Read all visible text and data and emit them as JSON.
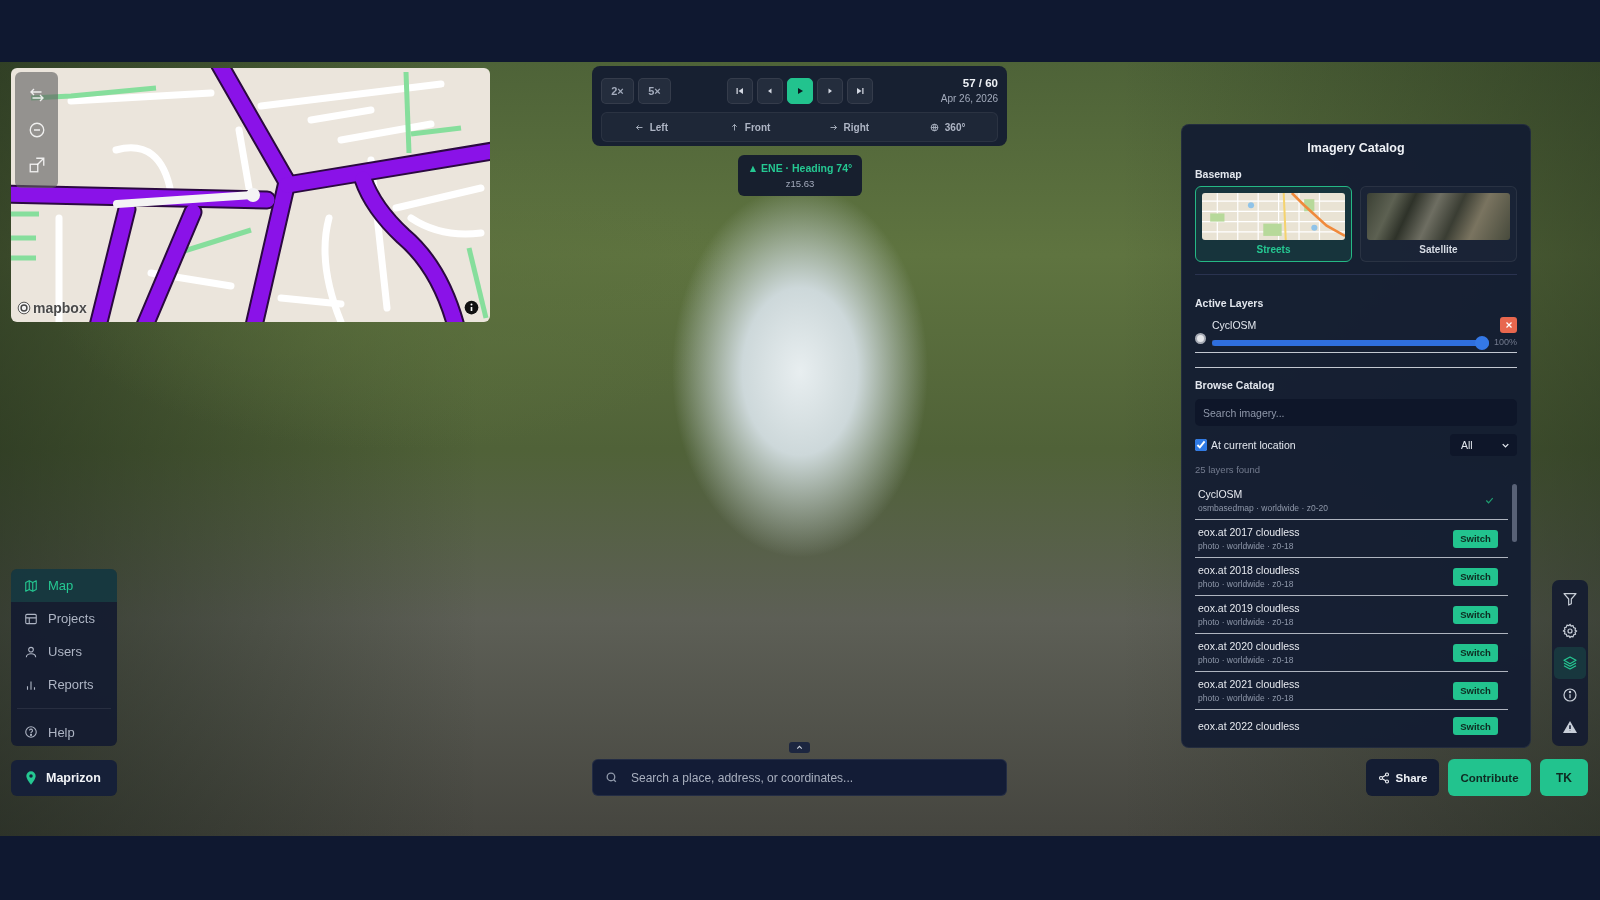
{
  "map_inset": {
    "attribution": "mapbox"
  },
  "playback": {
    "speeds": [
      {
        "label": "2×"
      },
      {
        "label": "5×"
      }
    ],
    "counter": "57 / 60",
    "date": "Apr 26, 2026",
    "directions": [
      {
        "kind": "left",
        "label": "Left"
      },
      {
        "kind": "front",
        "label": "Front"
      },
      {
        "kind": "right",
        "label": "Right"
      },
      {
        "kind": "panorama",
        "label": "360°"
      }
    ]
  },
  "heading": {
    "direction": "▲ ENE · Heading 74°",
    "zoom": "z15.63"
  },
  "imagery_catalog": {
    "title": "Imagery Catalog",
    "basemap_label": "Basemap",
    "basemaps": [
      {
        "kind": "streets",
        "label": "Streets",
        "selected": true
      },
      {
        "kind": "satellite",
        "label": "Satellite",
        "selected": false
      }
    ],
    "active_layers_label": "Active Layers",
    "active_layers": [
      {
        "name": "CyclOSM",
        "selected": false,
        "level": 1,
        "reading": "100%"
      }
    ],
    "browse_label": "Browse Catalog",
    "search": {
      "placeholder": "Search imagery..."
    },
    "at_current_location": {
      "label": "At current location",
      "checked": true
    },
    "filter": {
      "value": "All"
    },
    "results_count": "25 layers found",
    "layers": [
      {
        "name": "CyclOSM",
        "meta": "osmbasedmap · worldwide · z0-20",
        "active": true
      },
      {
        "name": "eox.at 2017 cloudless",
        "meta": "photo · worldwide · z0-18",
        "active": false,
        "action": "Switch"
      },
      {
        "name": "eox.at 2018 cloudless",
        "meta": "photo · worldwide · z0-18",
        "active": false,
        "action": "Switch"
      },
      {
        "name": "eox.at 2019 cloudless",
        "meta": "photo · worldwide · z0-18",
        "active": false,
        "action": "Switch"
      },
      {
        "name": "eox.at 2020 cloudless",
        "meta": "photo · worldwide · z0-18",
        "active": false,
        "action": "Switch"
      },
      {
        "name": "eox.at 2021 cloudless",
        "meta": "photo · worldwide · z0-18",
        "active": false,
        "action": "Switch"
      },
      {
        "name": "eox.at 2022 cloudless",
        "active": false,
        "action": "Switch"
      }
    ]
  },
  "tools": [
    {
      "kind": "filter",
      "selected": false
    },
    {
      "kind": "settings",
      "selected": false
    },
    {
      "kind": "layers",
      "selected": true
    },
    {
      "kind": "info",
      "selected": false
    },
    {
      "kind": "warning",
      "selected": false
    }
  ],
  "nav": {
    "items": [
      {
        "kind": "map",
        "label": "Map",
        "selected": true
      },
      {
        "kind": "projects",
        "label": "Projects",
        "selected": false
      },
      {
        "kind": "users",
        "label": "Users",
        "selected": false
      },
      {
        "kind": "reports",
        "label": "Reports",
        "selected": false
      }
    ],
    "secondary": [
      {
        "kind": "help",
        "label": "Help",
        "selected": false
      }
    ]
  },
  "brand": {
    "name": "Maprizon"
  },
  "search": {
    "placeholder": "Search a place, address, or coordinates..."
  },
  "actions": {
    "share": "Share",
    "contribute": "Contribute",
    "user_initials": "TK"
  }
}
